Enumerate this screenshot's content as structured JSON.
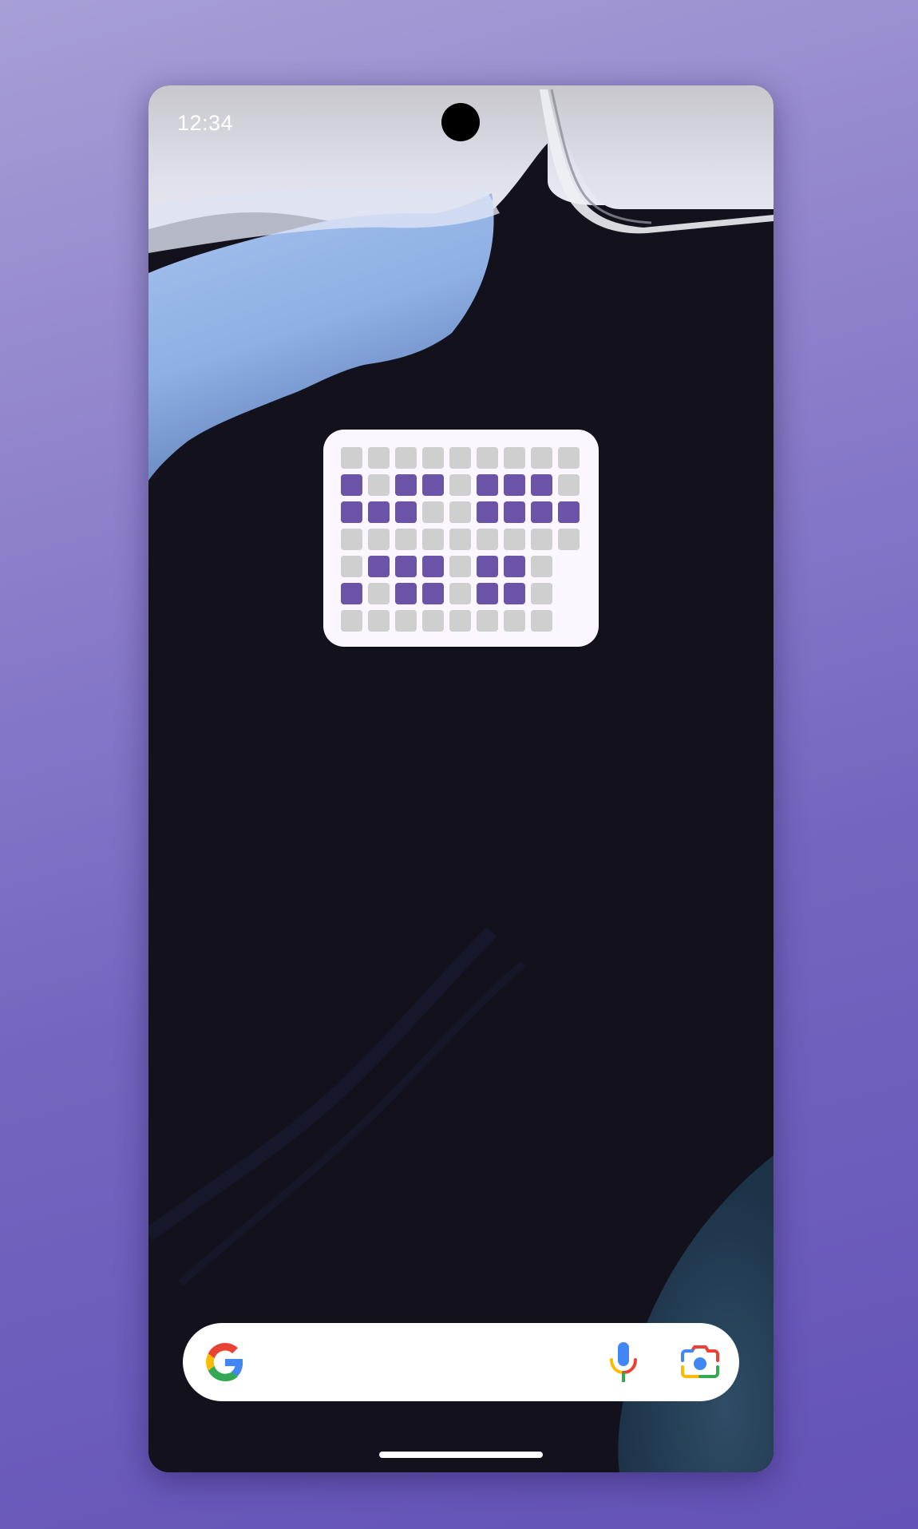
{
  "status_bar": {
    "time": "12:34"
  },
  "widget": {
    "accent_color": "#6b54a8",
    "empty_color": "#cfcfcf",
    "background_color": "#fbf6ff",
    "rows": [
      [
        0,
        0,
        0,
        0,
        0,
        0,
        0,
        0,
        0
      ],
      [
        1,
        0,
        1,
        1,
        0,
        1,
        1,
        1,
        0
      ],
      [
        1,
        1,
        1,
        0,
        0,
        1,
        1,
        1,
        1
      ],
      [
        0,
        0,
        0,
        0,
        0,
        0,
        0,
        0,
        0
      ],
      [
        0,
        1,
        1,
        1,
        0,
        1,
        1,
        0
      ],
      [
        1,
        0,
        1,
        1,
        0,
        1,
        1,
        0
      ],
      [
        0,
        0,
        0,
        0,
        0,
        0,
        0,
        0
      ]
    ]
  },
  "search_bar": {
    "logo_icon": "google-g-icon",
    "mic_icon": "microphone-icon",
    "lens_icon": "google-lens-camera-icon"
  },
  "colors": {
    "page_background": "#7a6cc4",
    "phone_background": "#12111c",
    "google_blue": "#4285f4",
    "google_red": "#ea4335",
    "google_yellow": "#fbbc05",
    "google_green": "#34a853"
  }
}
